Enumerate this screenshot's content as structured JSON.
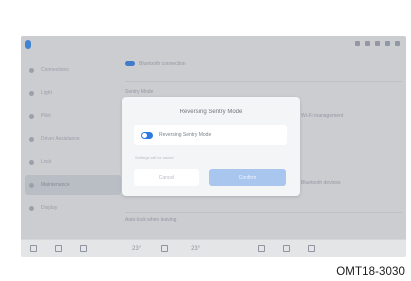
{
  "screen": {
    "sidebar": [
      {
        "label": "Connections"
      },
      {
        "label": "Light"
      },
      {
        "label": "Pilot"
      },
      {
        "label": "Driver Assistance"
      },
      {
        "label": "Lock"
      },
      {
        "label": "Maintenance"
      },
      {
        "label": "Display"
      }
    ],
    "content": {
      "top_row": "Bluetooth connection",
      "sentry_label": "Sentry Mode",
      "right_row_1": "Wi-Fi management",
      "right_row_2": "Bluetooth devices",
      "bottom_row": "Auto-lock when leaving"
    },
    "bottom_bar": {
      "left_temp": "23°",
      "right_temp": "23°"
    }
  },
  "dialog": {
    "title": "Reversing Sentry Mode",
    "option_label": "Reversing Sentry Mode",
    "note": "Settings will be saved",
    "cancel_label": "Cancel",
    "confirm_label": "Confirm"
  },
  "caption": "OMT18-3030"
}
